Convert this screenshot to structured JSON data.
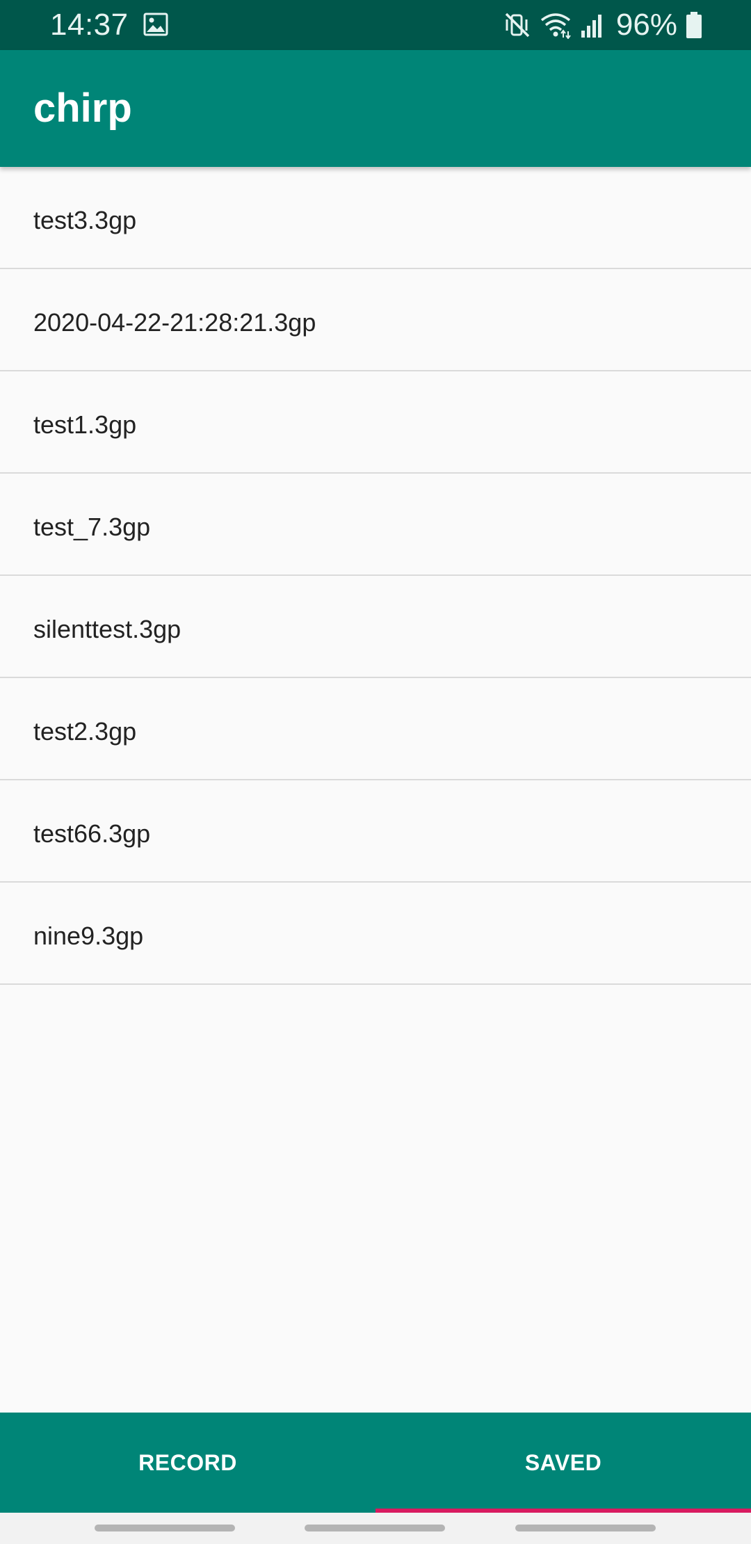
{
  "status_bar": {
    "time": "14:37",
    "battery_percent": "96%",
    "icons": [
      "gallery-icon",
      "mute-vibrate-icon",
      "wifi-icon",
      "signal-icon",
      "battery-icon"
    ]
  },
  "app_bar": {
    "title": "chirp"
  },
  "recordings": {
    "items": [
      {
        "name": "test3.3gp"
      },
      {
        "name": "2020-04-22-21:28:21.3gp"
      },
      {
        "name": "test1.3gp"
      },
      {
        "name": "test_7.3gp"
      },
      {
        "name": "silenttest.3gp"
      },
      {
        "name": "test2.3gp"
      },
      {
        "name": "test66.3gp"
      },
      {
        "name": "nine9.3gp"
      }
    ]
  },
  "tabs": {
    "record_label": "RECORD",
    "saved_label": "SAVED",
    "selected": "SAVED"
  },
  "colors": {
    "primary": "#008577",
    "primary_dark": "#00574B",
    "accent": "#D81B60",
    "background": "#FAFAFA"
  }
}
